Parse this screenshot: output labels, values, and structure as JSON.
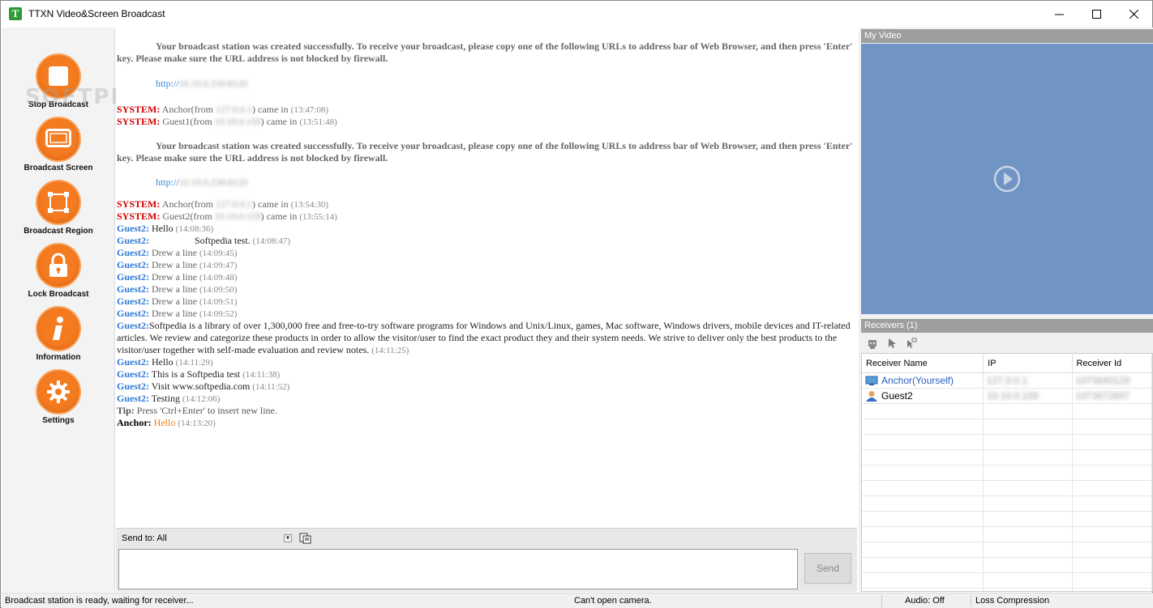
{
  "window": {
    "title": "TTXN  Video&Screen Broadcast",
    "app_icon_letter": "T"
  },
  "watermark": "SOFTPEDIA",
  "toolbar": [
    {
      "label": "Stop Broadcast",
      "icon": "stop-icon"
    },
    {
      "label": "Broadcast Screen",
      "icon": "monitor-icon"
    },
    {
      "label": "Broadcast Region",
      "icon": "region-icon"
    },
    {
      "label": "Lock Broadcast",
      "icon": "lock-icon"
    },
    {
      "label": "Information",
      "icon": "info-icon"
    },
    {
      "label": "Settings",
      "icon": "gear-icon"
    }
  ],
  "chat": {
    "notice": "Your broadcast station was created successfully. To receive your broadcast, please copy one of the following URLs to address bar of Web Browser, and then press 'Enter' key. Please make sure the URL address is not blocked by firewall.",
    "url_prefix": "http://",
    "url_blur": "10.10.0.230:8120",
    "system_label": "SYSTEM:",
    "messages_block1": [
      {
        "who": "Anchor(from ",
        "ip": "127.0.0.1",
        "rest": ") came in ",
        "ts": "(13:47:08)"
      },
      {
        "who": "Guest1(from ",
        "ip": "10.10.0.159",
        "rest": ") came in ",
        "ts": "(13:51:48)"
      }
    ],
    "messages_block2": [
      {
        "who": "Anchor(from ",
        "ip": "127.0.0.1",
        "rest": ") came in ",
        "ts": "(13:54:30)"
      },
      {
        "who": "Guest2(from ",
        "ip": "10.10.0.159",
        "rest": ") came in ",
        "ts": "(13:55:14)"
      }
    ],
    "guest_label": "Guest2:",
    "guest_lines": [
      {
        "text": "Hello",
        "ts": "(14:08:36)",
        "grey": false
      },
      {
        "text": "Softpedia test.",
        "ts": "(14:08:47)",
        "grey": false,
        "indent": true
      },
      {
        "text": " Drew a line",
        "ts": "(14:09:45)",
        "grey": true
      },
      {
        "text": " Drew a line",
        "ts": "(14:09:47)",
        "grey": true
      },
      {
        "text": " Drew a line",
        "ts": "(14:09:48)",
        "grey": true
      },
      {
        "text": " Drew a line",
        "ts": "(14:09:50)",
        "grey": true
      },
      {
        "text": " Drew a line",
        "ts": "(14:09:51)",
        "grey": true
      },
      {
        "text": " Drew a line",
        "ts": "(14:09:52)",
        "grey": true
      }
    ],
    "long_msg": "Softpedia is a library of over 1,300,000 free and free-to-try software programs for Windows and Unix/Linux, games, Mac software, Windows drivers, mobile devices and IT-related articles. We review and categorize these products in order to allow the visitor/user to find the exact product they and their system needs. We strive to deliver only the best products to the visitor/user together with self-made evaluation and review notes.",
    "long_ts": "(14:11:25)",
    "guest_lines2": [
      {
        "text": "Hello",
        "ts": "(14:11:29)"
      },
      {
        "text": "This is a Softpedia test",
        "ts": "(14:11:38)"
      },
      {
        "text": "Visit www.softpedia.com",
        "ts": "(14:11:52)"
      },
      {
        "text": "Testing",
        "ts": "(14:12:06)"
      }
    ],
    "tip_label": "Tip:",
    "tip_text": " Press 'Ctrl+Enter' to insert new line.",
    "anchor_label": "Anchor:",
    "anchor_text": "Hello",
    "anchor_ts": "(14:13:20)"
  },
  "send": {
    "to_label": "Send to: All",
    "button": "Send",
    "input_value": ""
  },
  "my_video": {
    "header": "My Video"
  },
  "receivers": {
    "header": "Receivers (1)",
    "columns": [
      "Receiver Name",
      "IP",
      "Receiver Id"
    ],
    "rows": [
      {
        "name": "Anchor(Yourself)",
        "ip": "127.0.0.1",
        "id": "1073840129",
        "self": true
      },
      {
        "name": "Guest2",
        "ip": "10.10.0.159",
        "id": "1073672897",
        "self": false
      }
    ]
  },
  "status": {
    "main": "Broadcast station is ready, waiting for receiver...",
    "camera": "Can't open  camera.",
    "audio": "Audio: Off",
    "compression": "Loss Compression"
  },
  "colors": {
    "accent": "#f47b20",
    "system": "#d20000",
    "guest": "#2f7ad6",
    "video_bg": "#7094c4"
  }
}
